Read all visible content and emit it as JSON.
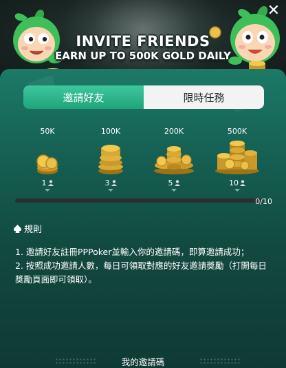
{
  "banner": {
    "title": "INVITE FRIENDS",
    "subtitle": "EARN UP TO 500K GOLD DAILY",
    "close_icon": "close-icon"
  },
  "tabs": [
    {
      "label": "邀請好友",
      "active": true
    },
    {
      "label": "限時任務",
      "active": false
    }
  ],
  "tiers": [
    {
      "amount": "50K",
      "friends": "1"
    },
    {
      "amount": "100K",
      "friends": "3"
    },
    {
      "amount": "200K",
      "friends": "5"
    },
    {
      "amount": "500K",
      "friends": "10"
    }
  ],
  "progress": {
    "text": "0/10",
    "fraction": 0
  },
  "rules": {
    "title": "規則",
    "icon": "spade-icon",
    "line1": "1. 邀請好友註冊PPPoker並輸入你的邀請碼，即算邀請成功；",
    "line2": "2. 按照成功邀請人數，每日可領取對應的好友邀請獎勵（打開每日獎勵頁面即可領取）。"
  },
  "footer": {
    "invite_code_label": "我的邀請碼"
  },
  "colors": {
    "accent": "#2bb888",
    "panel": "#155f52",
    "coin": "#e8c14a"
  }
}
